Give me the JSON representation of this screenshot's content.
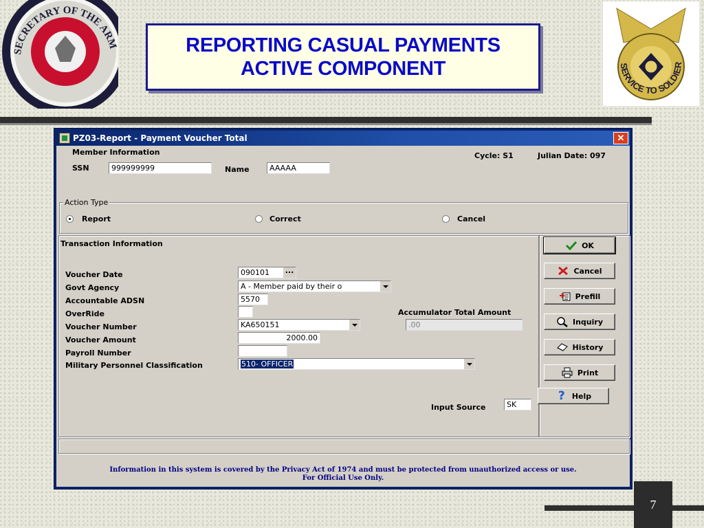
{
  "slide": {
    "title_line1": "REPORTING CASUAL PAYMENTS",
    "title_line2": "ACTIVE COMPONENT",
    "page_number": "7",
    "left_seal_text": "SECRETARY OF THE ARMY",
    "right_seal_text": "SERVICE TO SOLDIERS"
  },
  "window": {
    "title": "PZ03-Report - Payment Voucher Total",
    "close_label": "✕"
  },
  "member_info": {
    "group_label": "Member Information",
    "cycle": "Cycle: S1",
    "julian_date": "Julian Date: 097",
    "ssn_label": "SSN",
    "ssn_value": "999999999",
    "name_label": "Name",
    "name_value": "AAAAA"
  },
  "action_type": {
    "group_label": "Action Type",
    "options": [
      "Report",
      "Correct",
      "Cancel"
    ],
    "selected": "Report"
  },
  "transaction": {
    "group_label": "Transaction Information",
    "voucher_date_label": "Voucher Date",
    "voucher_date_value": "090101",
    "voucher_date_btn": "...",
    "govt_agency_label": "Govt Agency",
    "govt_agency_value": "A - Member paid by their o",
    "adsn_label": "Accountable ADSN",
    "adsn_value": "5570",
    "override_label": "OverRide",
    "override_value": "",
    "voucher_number_label": "Voucher Number",
    "voucher_number_value": "KA650151",
    "voucher_amount_label": "Voucher Amount",
    "voucher_amount_value": "2000.00",
    "payroll_label": "Payroll Number",
    "payroll_value": "",
    "mpc_label": "Military Personnel Classification",
    "mpc_value": "510- OFFICER",
    "accum_label": "Accumulator Total Amount",
    "accum_value": ".00",
    "input_source_label": "Input Source",
    "input_source_value": "SK"
  },
  "buttons": {
    "ok": "OK",
    "cancel": "Cancel",
    "prefill": "Prefill",
    "inquiry": "Inquiry",
    "history": "History",
    "print": "Print",
    "help": "Help"
  },
  "footer": {
    "privacy_line1": "Information in this system is covered by the Privacy Act of 1974 and must be protected from unauthorized access or use.",
    "privacy_line2": "For Official Use Only."
  },
  "colors": {
    "title_text": "#0a0ac8",
    "window_title_bar": "#0a246a",
    "dialog_bg": "#d4d0c8",
    "privacy_text": "#000080"
  }
}
